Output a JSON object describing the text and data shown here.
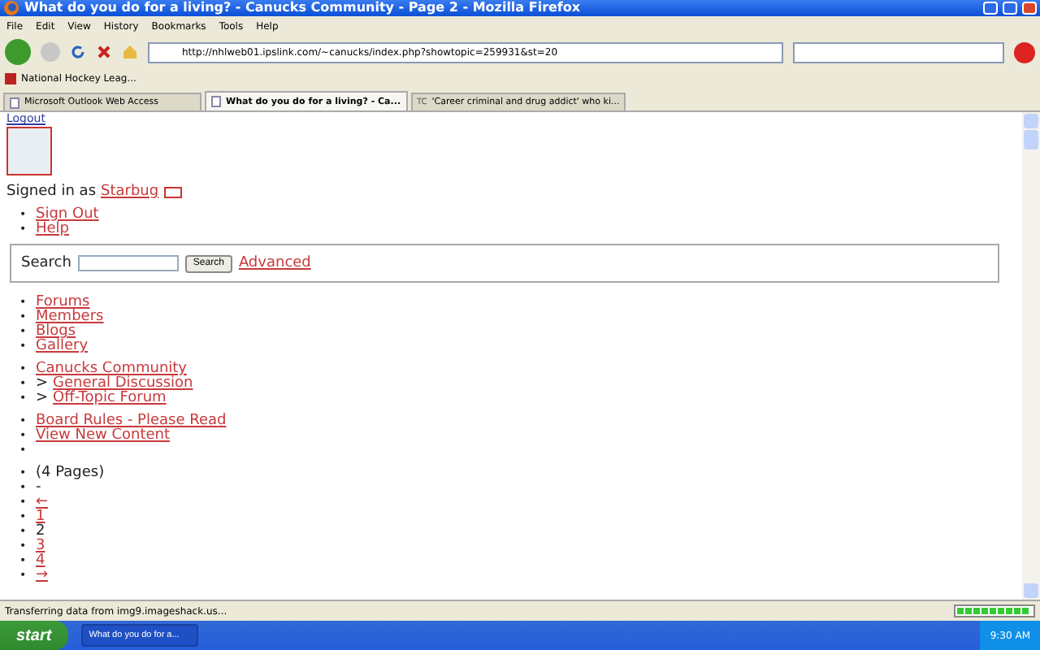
{
  "window": {
    "title": "What do you do for a living? - Canucks Community - Page 2 - Mozilla Firefox"
  },
  "menu": [
    "File",
    "Edit",
    "View",
    "History",
    "Bookmarks",
    "Tools",
    "Help"
  ],
  "address_bar": {
    "value": "http://nhlweb01.ipslink.com/~canucks/index.php?showtopic=259931&st=20"
  },
  "bookmarks": [
    "National Hockey Leag..."
  ],
  "tabs": [
    {
      "label": "Microsoft Outlook Web Access",
      "selected": false
    },
    {
      "label": "What do you do for a living? - Ca...",
      "selected": true
    },
    {
      "label": "'Career criminal and drug addict' who ki...",
      "icon_text": "TC",
      "selected": false
    }
  ],
  "page": {
    "logout": "Logout",
    "signed_in": "Signed in as",
    "username": "Starbug",
    "user_links": [
      {
        "bullet": "•",
        "text": "Sign Out"
      },
      {
        "bullet": "•",
        "text": "Help"
      }
    ],
    "search": {
      "label": "Search",
      "button": "Search",
      "advanced": "Advanced"
    },
    "nav_groups": [
      [
        {
          "kind": "link",
          "bullet": "•",
          "text": "Forums"
        },
        {
          "kind": "link",
          "bullet": "•",
          "text": "Members"
        },
        {
          "kind": "link",
          "bullet": "•",
          "text": "Blogs"
        },
        {
          "kind": "link",
          "bullet": "•",
          "text": "Gallery"
        }
      ],
      [
        {
          "kind": "link",
          "bullet": "•",
          "text": "Canucks Community"
        },
        {
          "kind": "link",
          "bullet": "•",
          "prefix": ">",
          "text": "General Discussion"
        },
        {
          "kind": "link",
          "bullet": "•",
          "prefix": ">",
          "text": "Off-Topic Forum"
        }
      ],
      [
        {
          "kind": "link",
          "bullet": "•",
          "text": "Board Rules - Please Read"
        },
        {
          "kind": "link",
          "bullet": "•",
          "text": "View New Content"
        },
        {
          "kind": "empty",
          "bullet": "•"
        }
      ]
    ],
    "pagination": [
      {
        "kind": "text",
        "bullet": "•",
        "text": "(4 Pages)"
      },
      {
        "kind": "text",
        "bullet": "•",
        "text": "-"
      },
      {
        "kind": "link",
        "bullet": "•",
        "text": "←"
      },
      {
        "kind": "link",
        "bullet": "•",
        "text": "1"
      },
      {
        "kind": "text",
        "bullet": "•",
        "text": "2"
      },
      {
        "kind": "link",
        "bullet": "•",
        "text": "3"
      },
      {
        "kind": "link",
        "bullet": "•",
        "text": "4"
      },
      {
        "kind": "link",
        "bullet": "•",
        "text": "→"
      }
    ]
  },
  "status_bar": {
    "text": "Transferring data from img9.imageshack.us...",
    "level": 0.95
  },
  "taskbar": {
    "start": "start",
    "task": "What do you do for a...",
    "clock": "9:30 AM"
  }
}
